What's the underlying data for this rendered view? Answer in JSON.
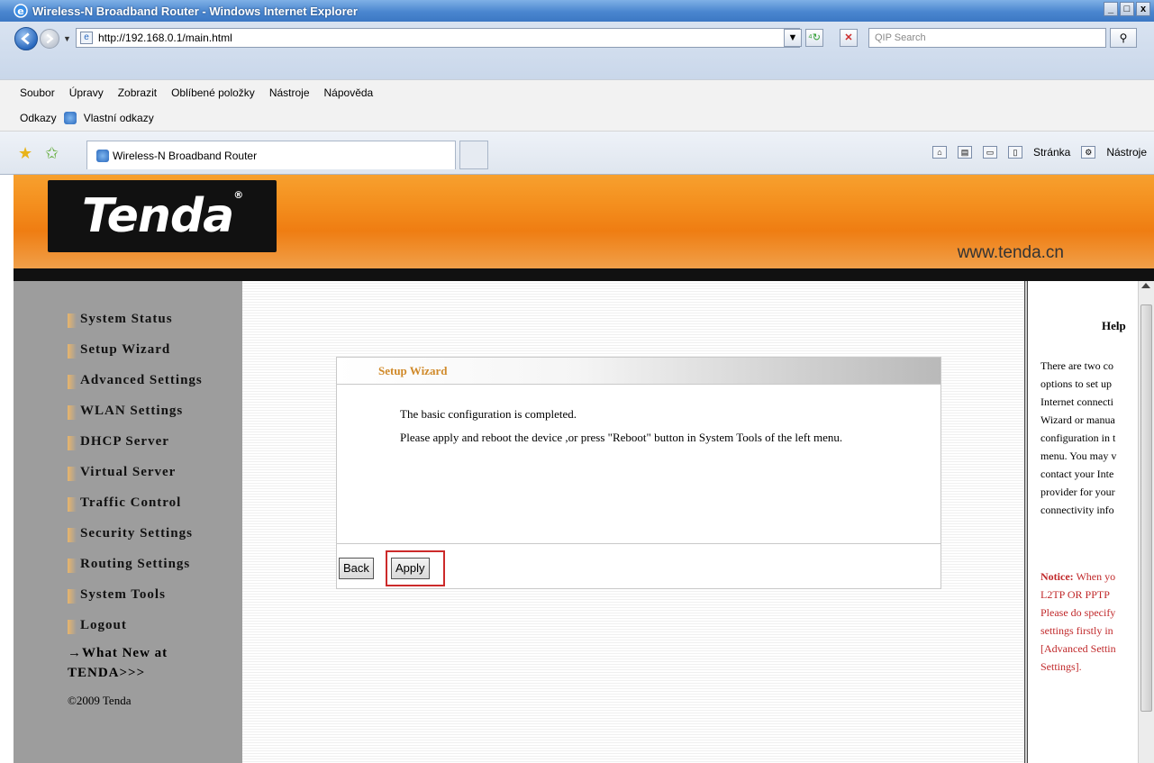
{
  "window": {
    "title": "Wireless-N Broadband Router - Windows Internet Explorer",
    "controls": [
      "_",
      "□",
      "x"
    ]
  },
  "address": {
    "url": "http://192.168.0.1/main.html",
    "search_placeholder": "QIP Search"
  },
  "menu": [
    "Soubor",
    "Úpravy",
    "Zobrazit",
    "Oblíbené položky",
    "Nástroje",
    "Nápověda"
  ],
  "links": {
    "label": "Odkazy",
    "item": "Vlastní odkazy"
  },
  "tab": {
    "title": "Wireless-N Broadband Router"
  },
  "commandbar": {
    "page": "Stránka",
    "tools": "Nástroje"
  },
  "router": {
    "logo": "Tenda",
    "site": "www.tenda.cn",
    "nav": [
      "System Status",
      "Setup Wizard",
      "Advanced Settings",
      "WLAN Settings",
      "DHCP Server",
      "Virtual Server",
      "Traffic Control",
      "Security Settings",
      "Routing Settings",
      "System Tools",
      "Logout"
    ],
    "whatnew_line1": "→What New at",
    "whatnew_line2": "TENDA>>>",
    "copyright": "©2009 Tenda"
  },
  "panel": {
    "title": "Setup Wizard",
    "line1": "The basic configuration is completed.",
    "line2": "Please apply and reboot the device ,or press \"Reboot\" button in System Tools of the left menu.",
    "back_label": "Back",
    "apply_label": "Apply"
  },
  "help": {
    "title": "Help",
    "lines": [
      "There are two co",
      "options to set up",
      "Internet connecti",
      "Wizard or manua",
      "configuration in t",
      "menu. You may v",
      "contact your Inte",
      "provider for your",
      "connectivity info"
    ],
    "notice_label": "Notice:",
    "notice_lines": [
      " When yo",
      "L2TP OR PPTP",
      "Please do specify",
      "settings firstly in",
      "[Advanced Settin",
      "Settings]."
    ]
  }
}
